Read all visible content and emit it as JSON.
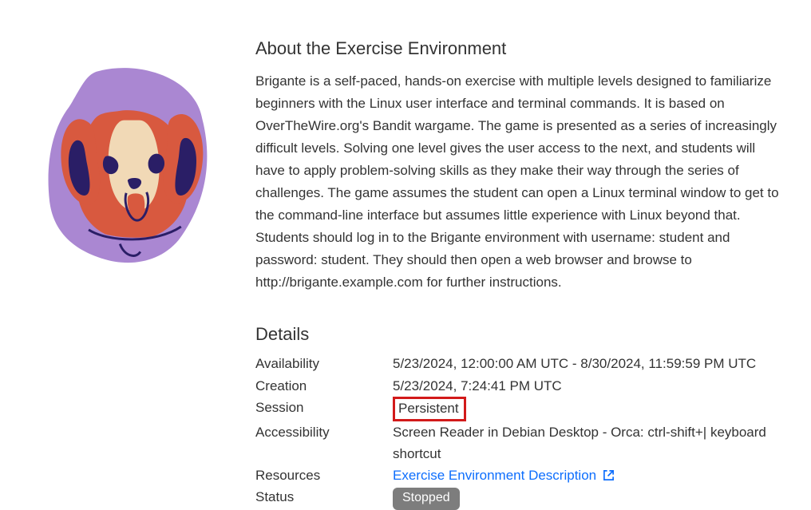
{
  "about": {
    "heading": "About the Exercise Environment",
    "body": "Brigante is a self-paced, hands-on exercise with multiple levels designed to familiarize beginners with the Linux user interface and terminal commands. It is based on OverTheWire.org's Bandit wargame. The game is presented as a series of increasingly difficult levels. Solving one level gives the user access to the next, and students will have to apply problem-solving skills as they make their way through the series of challenges. The game assumes the student can open a Linux terminal window to get to the command-line interface but assumes little experience with Linux beyond that. Students should log in to the Brigante environment with username: student and password: student. They should then open a web browser and browse to http://brigante.example.com for further instructions."
  },
  "details": {
    "heading": "Details",
    "rows": {
      "availability": {
        "label": "Availability",
        "value": "5/23/2024, 12:00:00 AM UTC - 8/30/2024, 11:59:59 PM UTC"
      },
      "creation": {
        "label": "Creation",
        "value": "5/23/2024, 7:24:41 PM UTC"
      },
      "session": {
        "label": "Session",
        "value": "Persistent"
      },
      "accessibility": {
        "label": "Accessibility",
        "value": "Screen Reader in Debian Desktop - Orca: ctrl-shift+| keyboard shortcut"
      },
      "resources": {
        "label": "Resources",
        "link_text": "Exercise Environment Description"
      },
      "status": {
        "label": "Status",
        "value": "Stopped"
      }
    }
  }
}
